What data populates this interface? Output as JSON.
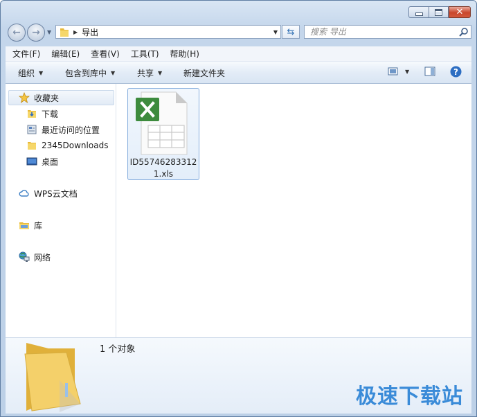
{
  "window": {
    "controls": {
      "minimize": "minimize",
      "maximize": "maximize",
      "close": "close"
    }
  },
  "address": {
    "path": "导出"
  },
  "search": {
    "placeholder": "搜索 导出"
  },
  "menu": [
    "文件(F)",
    "编辑(E)",
    "查看(V)",
    "工具(T)",
    "帮助(H)"
  ],
  "toolbar": {
    "organize": "组织",
    "include_in_library": "包含到库中",
    "share": "共享",
    "new_folder": "新建文件夹"
  },
  "sidebar": {
    "favorites": "收藏夹",
    "favorites_items": [
      "下载",
      "最近访问的位置",
      "2345Downloads",
      "桌面"
    ],
    "wps": "WPS云文档",
    "libraries": "库",
    "network": "网络"
  },
  "files": [
    {
      "name": "ID557462833121.xls",
      "icon": "excel-file-icon"
    }
  ],
  "details": {
    "count": "1 个对象"
  },
  "watermark": "极速下载站",
  "colors": {
    "accent": "#3a8bd8",
    "excel": "#3d8b3d",
    "folder": "#f2c84b"
  }
}
